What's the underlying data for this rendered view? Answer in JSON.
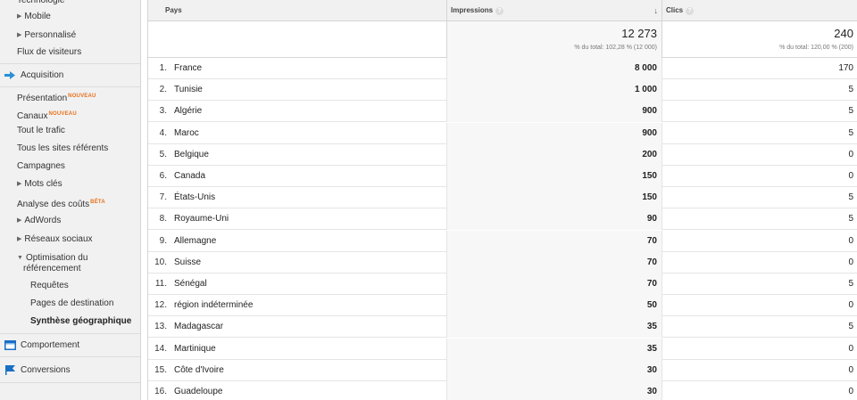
{
  "sidebar": {
    "top_cutoff": "Technologie",
    "mobile": "Mobile",
    "personnalise": "Personnalisé",
    "flux": "Flux de visiteurs",
    "acquisition": "Acquisition",
    "presentation": "Présentation",
    "presentation_badge": "NOUVEAU",
    "canaux": "Canaux",
    "canaux_badge": "NOUVEAU",
    "tout_trafic": "Tout le trafic",
    "sites_referents": "Tous les sites référents",
    "campagnes": "Campagnes",
    "mots_cles": "Mots clés",
    "analyse_couts": "Analyse des coûts",
    "analyse_badge": "BÊTA",
    "adwords": "AdWords",
    "reseaux_sociaux": "Réseaux sociaux",
    "optimisation_line1": "Optimisation du",
    "optimisation_line2": "référencement",
    "requetes": "Requêtes",
    "pages_destination": "Pages de destination",
    "synthese_geo": "Synthèse géographique",
    "comportement": "Comportement",
    "conversions": "Conversions"
  },
  "colors": {
    "accent_orange": "#e8711c",
    "acquisition_icon": "#2a8fd6",
    "comportement_icon": "#1a6fc4",
    "conversions_icon": "#1a6fc4"
  },
  "table": {
    "headers": {
      "pays": "Pays",
      "impressions": "Impressions",
      "clics": "Clics",
      "help_glyph": "?",
      "sort_glyph": "↓"
    },
    "totals": {
      "impressions": "12 273",
      "impressions_sub": "% du total: 102,28 % (12 000)",
      "clics": "240",
      "clics_sub": "% du total: 120,00 % (200)"
    },
    "rows": [
      {
        "rank": "1.",
        "country": "France",
        "impressions": "8 000",
        "clics": "170"
      },
      {
        "rank": "2.",
        "country": "Tunisie",
        "impressions": "1 000",
        "clics": "5"
      },
      {
        "rank": "3.",
        "country": "Algérie",
        "impressions": "900",
        "clics": "5"
      },
      {
        "rank": "4.",
        "country": "Maroc",
        "impressions": "900",
        "clics": "5"
      },
      {
        "rank": "5.",
        "country": "Belgique",
        "impressions": "200",
        "clics": "0"
      },
      {
        "rank": "6.",
        "country": "Canada",
        "impressions": "150",
        "clics": "0"
      },
      {
        "rank": "7.",
        "country": "États-Unis",
        "impressions": "150",
        "clics": "5"
      },
      {
        "rank": "8.",
        "country": "Royaume-Uni",
        "impressions": "90",
        "clics": "5"
      },
      {
        "rank": "9.",
        "country": "Allemagne",
        "impressions": "70",
        "clics": "0"
      },
      {
        "rank": "10.",
        "country": "Suisse",
        "impressions": "70",
        "clics": "0"
      },
      {
        "rank": "11.",
        "country": "Sénégal",
        "impressions": "70",
        "clics": "5"
      },
      {
        "rank": "12.",
        "country": "région indéterminée",
        "impressions": "50",
        "clics": "0"
      },
      {
        "rank": "13.",
        "country": "Madagascar",
        "impressions": "35",
        "clics": "5"
      },
      {
        "rank": "14.",
        "country": "Martinique",
        "impressions": "35",
        "clics": "0"
      },
      {
        "rank": "15.",
        "country": "Côte d'Ivoire",
        "impressions": "30",
        "clics": "0"
      },
      {
        "rank": "16.",
        "country": "Guadeloupe",
        "impressions": "30",
        "clics": "0"
      }
    ]
  }
}
